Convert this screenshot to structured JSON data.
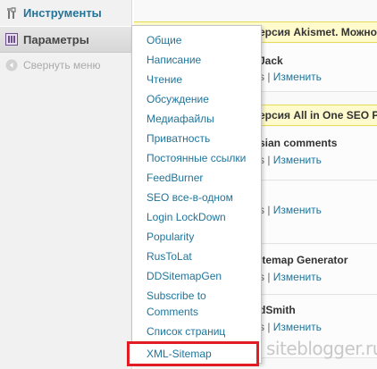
{
  "sidebar": {
    "tools_label": "Инструменты",
    "params_label": "Параметры",
    "collapse_label": "Свернуть меню"
  },
  "submenu": {
    "items": [
      "Общие",
      "Написание",
      "Чтение",
      "Обсуждение",
      "Медиафайлы",
      "Приватность",
      "Постоянные ссылки",
      "FeedBurner",
      "SEO все-в-одном",
      "Login LockDown",
      "Popularity",
      "RusToLat",
      "DDSitemapGen",
      "Subscribe to Comments",
      "Список страниц",
      "XML-Sitemap"
    ],
    "highlighted": "XML-Sitemap"
  },
  "main": {
    "notice_1": "ерсия Akismet. Можно",
    "plugin_1": "Jack",
    "notice_2": "ерсия All in One SEO Pa",
    "plugin_2": "sian comments",
    "plugin_4": "itemap Generator",
    "plugin_5": "dSmith",
    "links_sep": "s | ",
    "edit_link": "Изменить"
  },
  "watermark": "siteblogger.ru",
  "colors": {
    "link": "#21759b",
    "highlight_border": "#e21c24",
    "notice_bg": "#fffbcc"
  }
}
